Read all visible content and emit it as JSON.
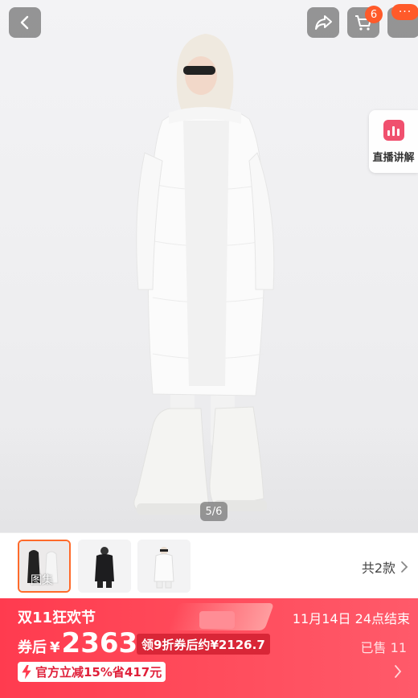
{
  "gallery": {
    "page_indicator": "5/6",
    "live_label": "直播讲解",
    "cart_count": "6",
    "more_dots": "···",
    "thumbnails": [
      {
        "caption": "图集"
      },
      {
        "caption": ""
      },
      {
        "caption": ""
      }
    ],
    "style_count": "共2款"
  },
  "promo": {
    "festival": "双11狂欢节",
    "end_time": "11月14日 24点结束",
    "price_prefix": "券后",
    "currency": "¥",
    "price": "2363",
    "coupon_tag": "领9折券后约¥2126.7",
    "sold": "已售 11",
    "saving": "官方立减15%省417元"
  },
  "colors": {
    "accent": "#ff3b4f",
    "badge": "#ff5a2a"
  },
  "icons": [
    "back-arrow-icon",
    "share-icon",
    "cart-icon",
    "more-icon",
    "live-stream-icon",
    "bolt-icon",
    "chevron-right-icon"
  ]
}
